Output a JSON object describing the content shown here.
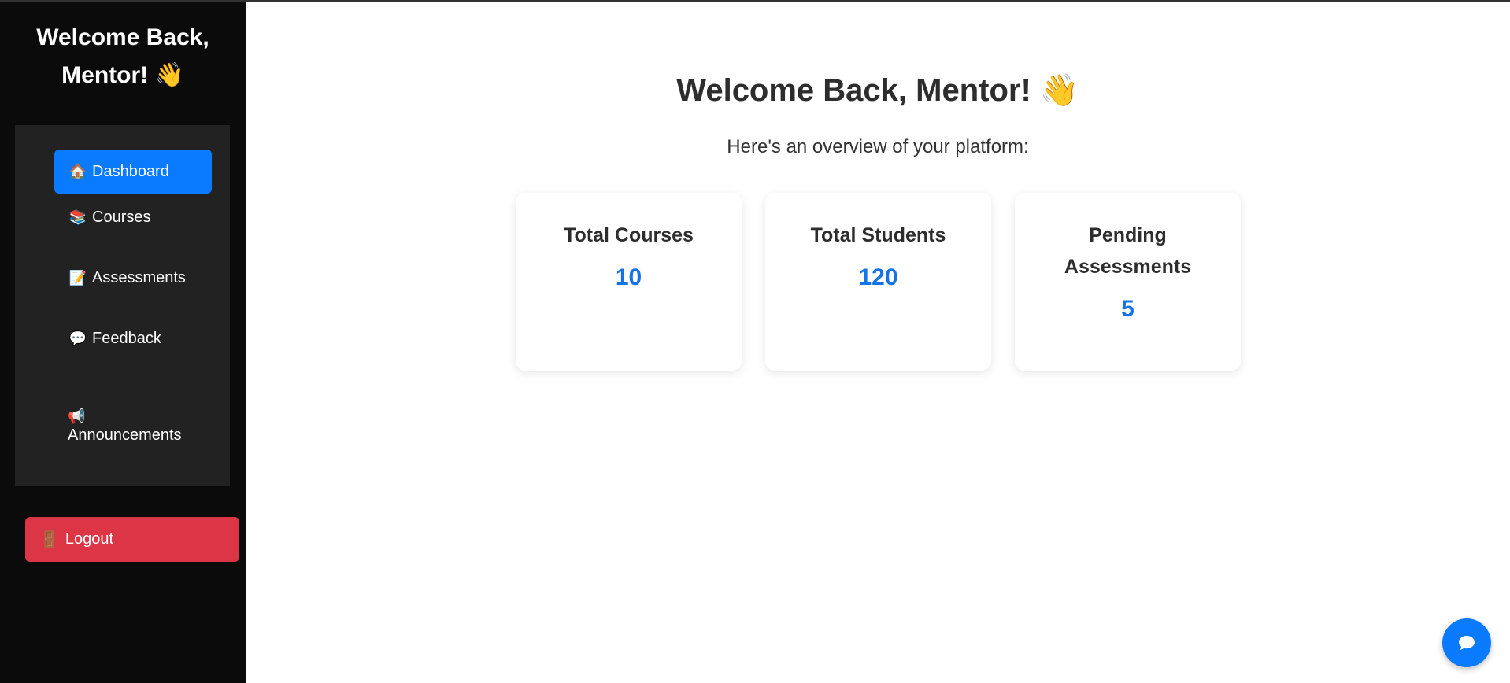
{
  "sidebar": {
    "title": "Welcome Back, Mentor! 👋",
    "nav": [
      {
        "icon": "🏠",
        "icon_name": "home-icon",
        "label": "Dashboard",
        "active": true
      },
      {
        "icon": "📚",
        "icon_name": "books-icon",
        "label": "Courses"
      },
      {
        "icon": "📝",
        "icon_name": "memo-icon",
        "label": "Assessments"
      },
      {
        "icon": "💬",
        "icon_name": "speech-bubble-icon",
        "label": "Feedback"
      },
      {
        "icon": "📢",
        "icon_name": "megaphone-icon",
        "label": "Announcements"
      }
    ],
    "logout": {
      "icon": "🚪",
      "icon_name": "door-icon",
      "label": "Logout"
    }
  },
  "main": {
    "heading": "Welcome Back, Mentor! 👋",
    "subheading": "Here's an overview of your platform:",
    "cards": [
      {
        "title": "Total Courses",
        "value": "10"
      },
      {
        "title": "Total Students",
        "value": "120"
      },
      {
        "title": "Pending Assessments",
        "value": "5"
      }
    ]
  },
  "chat": {
    "icon_name": "chat-icon"
  },
  "colors": {
    "sidebar_bg": "#0b0b0b",
    "nav_panel_bg": "#222222",
    "accent": "#0a7bff",
    "logout": "#dc3545",
    "stat_value": "#1473e6"
  }
}
